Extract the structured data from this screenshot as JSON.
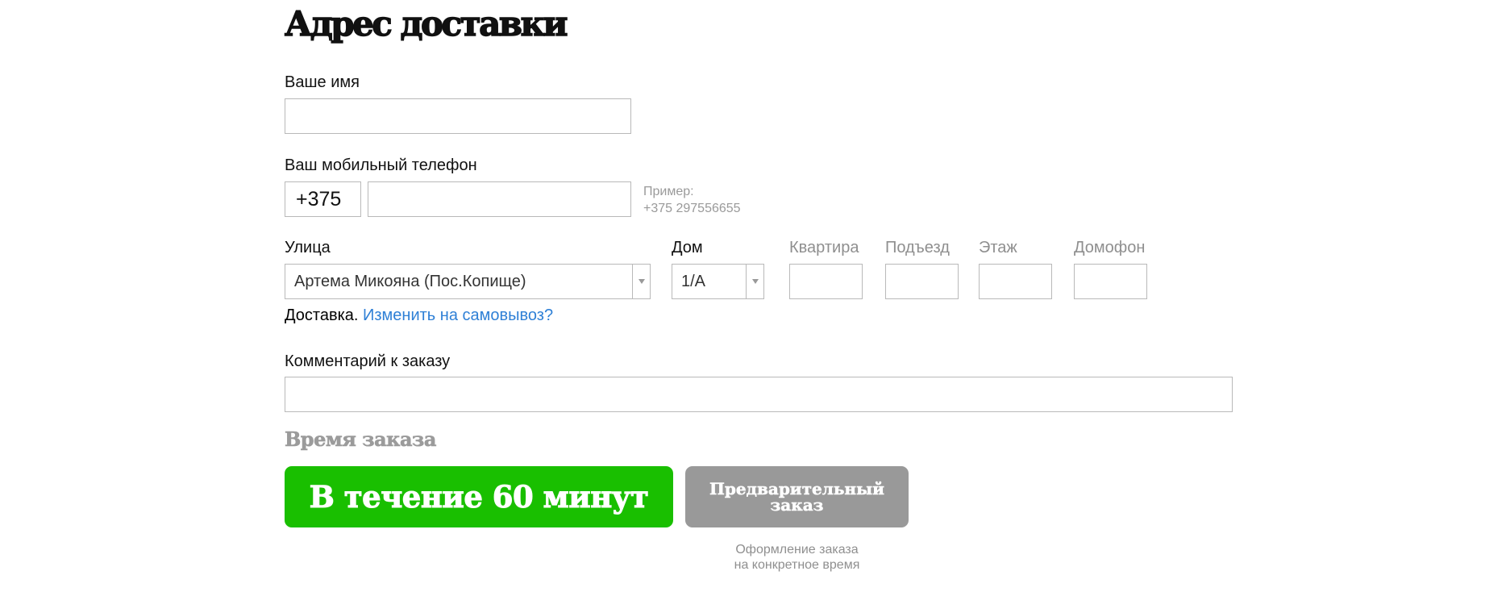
{
  "heading": "Адрес доставки",
  "name_field": {
    "label": "Ваше имя",
    "value": ""
  },
  "phone_field": {
    "label": "Ваш мобильный телефон",
    "prefix": "+375",
    "value": "",
    "hint_line1": "Пример:",
    "hint_line2": "+375 297556655"
  },
  "street": {
    "label": "Улица",
    "value": "Артема Микояна (Пос.Копище)"
  },
  "house": {
    "label": "Дом",
    "value": "1/А"
  },
  "apartment": {
    "label": "Квартира",
    "value": ""
  },
  "entrance": {
    "label": "Подъезд",
    "value": ""
  },
  "floor": {
    "label": "Этаж",
    "value": ""
  },
  "intercom": {
    "label": "Домофон",
    "value": ""
  },
  "delivery": {
    "text": "Доставка.",
    "link": "Изменить на самовывоз?"
  },
  "comment": {
    "label": "Комментарий к заказу",
    "value": ""
  },
  "order_time": {
    "heading": "Время заказа",
    "primary_button": "В течение 60 минут",
    "secondary_button_line1": "Предварительный",
    "secondary_button_line2": "заказ",
    "note_line1": "Оформление заказа",
    "note_line2": "на конкретное время"
  },
  "colors": {
    "primary_green": "#19bf00",
    "secondary_gray": "#999999",
    "link_blue": "#2f80d6"
  }
}
